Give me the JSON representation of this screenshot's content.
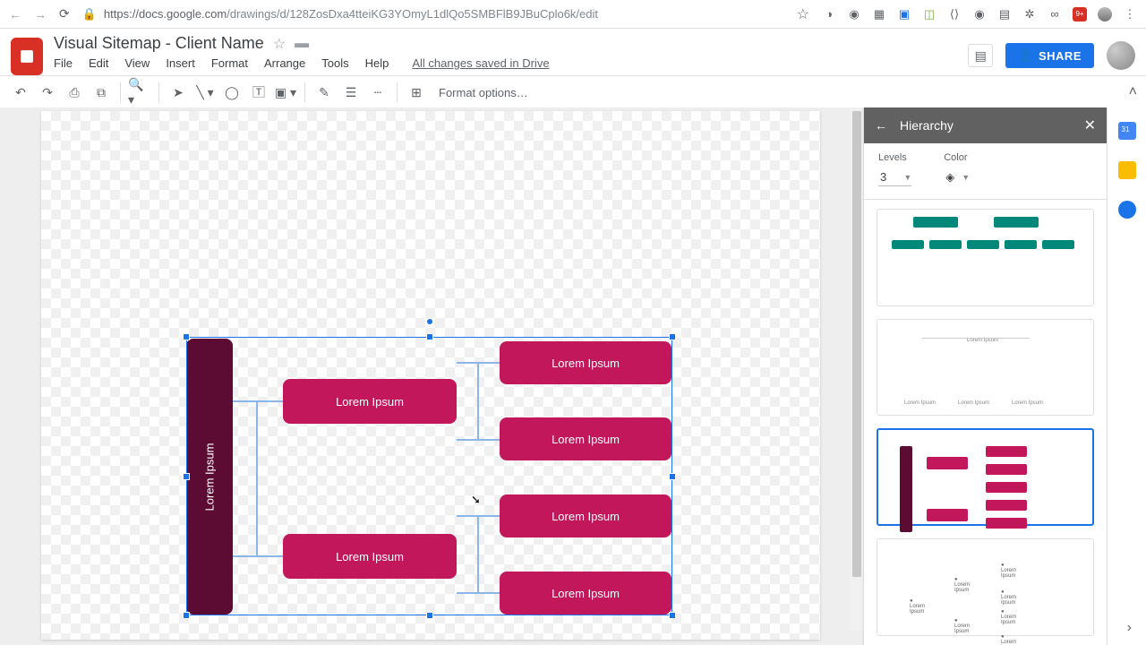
{
  "browser": {
    "url_host": "https://docs.google.com",
    "url_path": "/drawings/d/128ZosDxa4tteiKG3YOmyL1dlQo5SMBFlB9JBuCplo6k/edit",
    "notification_badge": "9+"
  },
  "doc": {
    "title": "Visual Sitemap - Client Name",
    "menus": [
      "File",
      "Edit",
      "View",
      "Insert",
      "Format",
      "Arrange",
      "Tools",
      "Help"
    ],
    "save_state": "All changes saved in Drive",
    "share_label": "SHARE"
  },
  "toolbar": {
    "format_options": "Format options…"
  },
  "diagram": {
    "root": "Lorem Ipsum",
    "mid": [
      "Lorem Ipsum",
      "Lorem Ipsum"
    ],
    "leaves": [
      "Lorem Ipsum",
      "Lorem Ipsum",
      "Lorem Ipsum",
      "Lorem Ipsum"
    ]
  },
  "panel": {
    "title": "Hierarchy",
    "levels_label": "Levels",
    "levels_value": "3",
    "color_label": "Color"
  },
  "colors": {
    "accent": "#1a73e8",
    "root_box": "#5c0b33",
    "crimson": "#c2185b",
    "teal": "#00897b"
  }
}
